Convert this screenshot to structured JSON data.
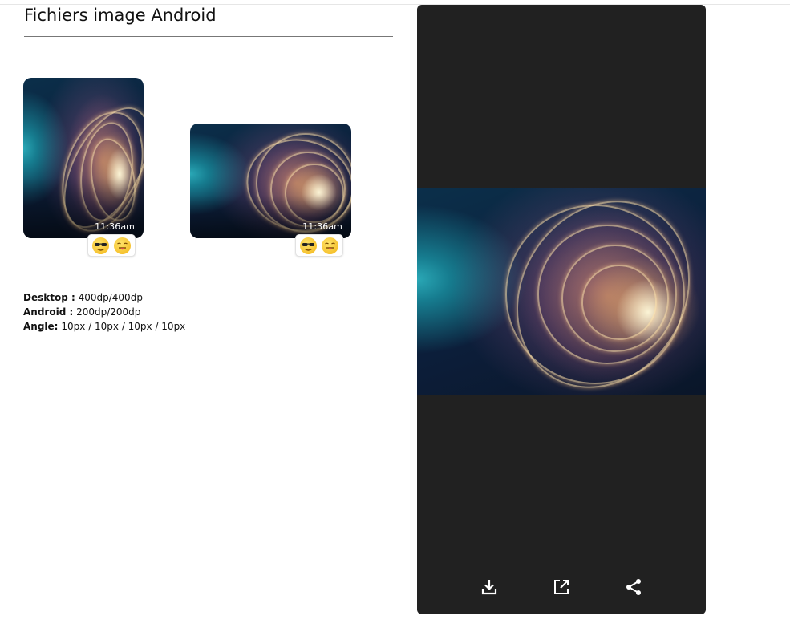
{
  "page": {
    "title": "Fichiers image Android"
  },
  "messages": [
    {
      "time": "11:36am",
      "reactions": [
        "sunglasses-face",
        "tongue-face"
      ]
    },
    {
      "time": "11:36am",
      "reactions": [
        "sunglasses-face",
        "tongue-face"
      ]
    }
  ],
  "specs": {
    "desktop": {
      "label": "Desktop :",
      "value": "400dp/400dp"
    },
    "android": {
      "label": "Android :",
      "value": "200dp/200dp"
    },
    "angle": {
      "label": "Angle:",
      "value": "10px / 10px / 10px / 10px"
    }
  },
  "viewer": {
    "actions": [
      "download-icon",
      "open-external-icon",
      "share-icon"
    ]
  },
  "colors": {
    "viewer_background": "#212121",
    "title_rule": "#777777"
  }
}
